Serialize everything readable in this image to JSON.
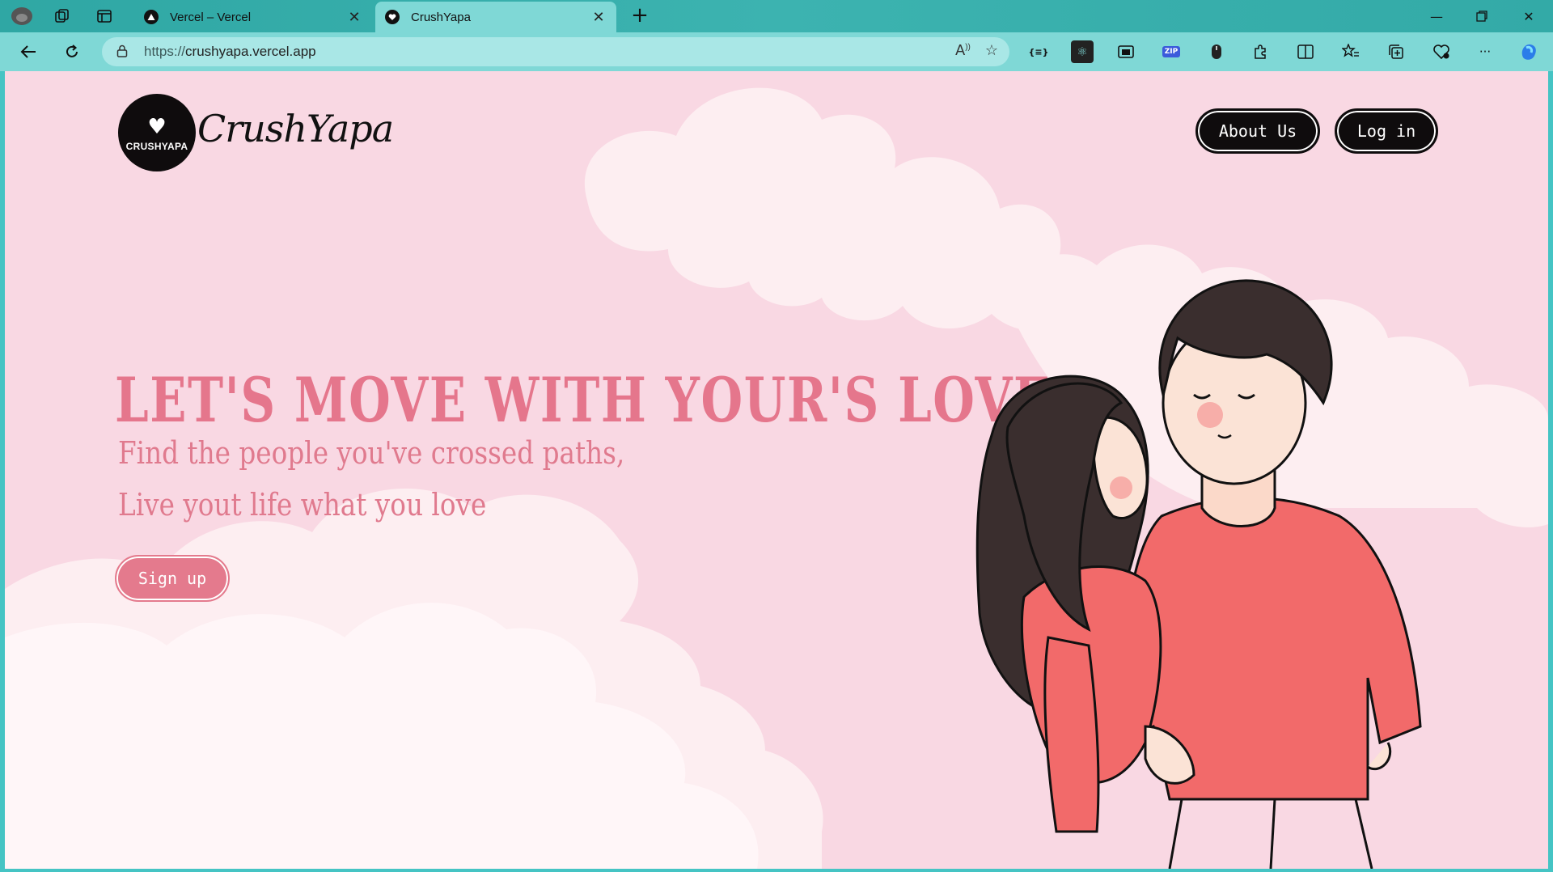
{
  "browser": {
    "tabs": [
      {
        "title": "Vercel – Vercel",
        "active": false
      },
      {
        "title": "CrushYapa",
        "active": true
      }
    ],
    "url_protocol": "https://",
    "url_host": "crushyapa.vercel.app"
  },
  "site": {
    "logo_text": "CRUSHYAPA",
    "brand_name": "CrushYapa",
    "nav": {
      "about": "About Us",
      "login": "Log in"
    },
    "hero": {
      "headline": "LET'S MOVE WITH YOUR'S LOVE",
      "subline1": "Find the people you've crossed paths,",
      "subline2": "Live yout life what you love",
      "cta": "Sign up"
    }
  },
  "colors": {
    "page_bg": "#f9d8e3",
    "accent_pink": "#e5768c",
    "dark": "#0f0c0d",
    "shirt": "#f26a6a",
    "browser_teal": "#7fd8d6"
  }
}
